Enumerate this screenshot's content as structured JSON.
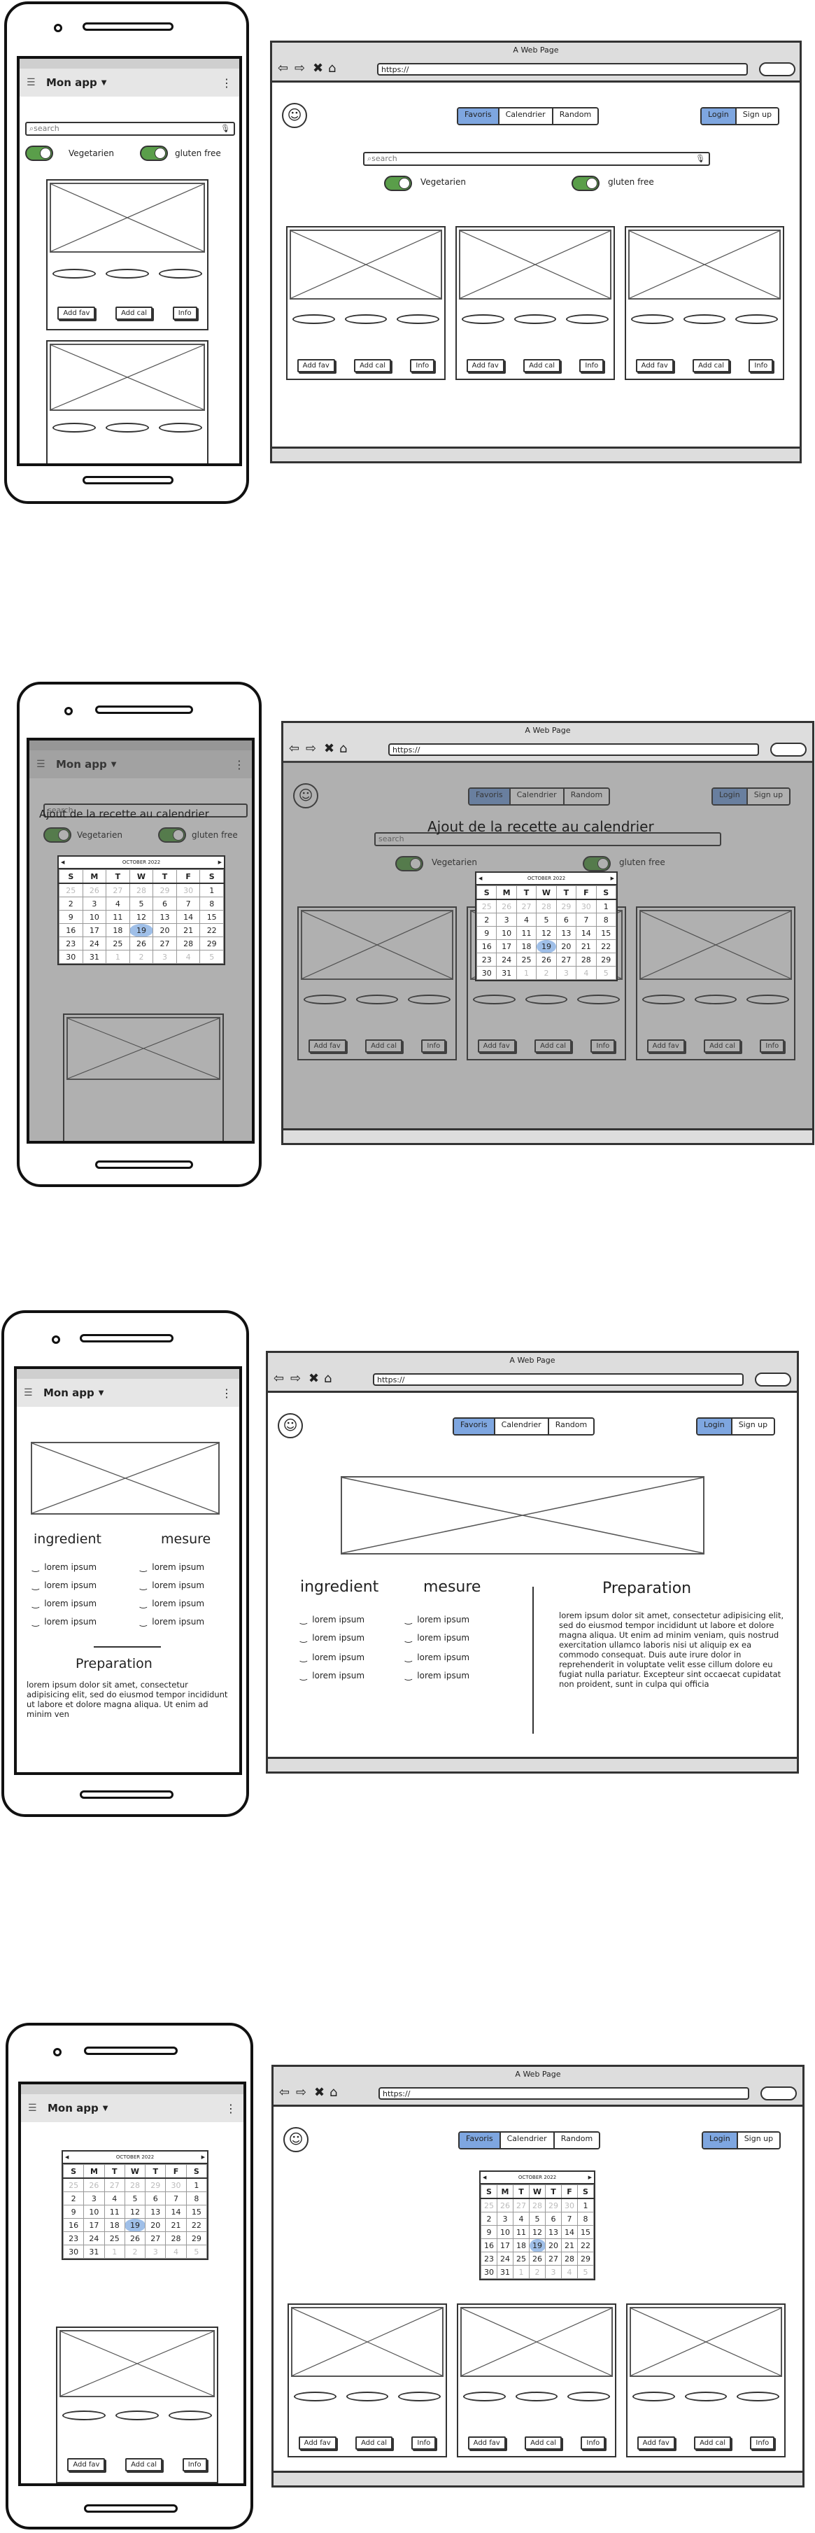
{
  "app_title": "Mon app",
  "browser_title": "A Web Page",
  "url": "https://",
  "nav_tabs": [
    "Favoris",
    "Calendrier",
    "Random"
  ],
  "auth": {
    "login": "Login",
    "signup": "Sign up"
  },
  "search": {
    "placeholder": "search"
  },
  "filters": {
    "vegetarien": "Vegetarien",
    "gluten_free": "gluten free"
  },
  "card_buttons": {
    "add_fav": "Add fav",
    "add_cal": "Add cal",
    "info": "Info"
  },
  "modal_title": "Ajout de la recette au calendrier",
  "calendar": {
    "month": "OCTOBER 2022",
    "weekdays": [
      "S",
      "M",
      "T",
      "W",
      "T",
      "F",
      "S"
    ],
    "rows": [
      [
        "25",
        "26",
        "27",
        "28",
        "29",
        "30",
        "1"
      ],
      [
        "2",
        "3",
        "4",
        "5",
        "6",
        "7",
        "8"
      ],
      [
        "9",
        "10",
        "11",
        "12",
        "13",
        "14",
        "15"
      ],
      [
        "16",
        "17",
        "18",
        "19",
        "20",
        "21",
        "22"
      ],
      [
        "23",
        "24",
        "25",
        "26",
        "27",
        "28",
        "29"
      ],
      [
        "30",
        "31",
        "1",
        "2",
        "3",
        "4",
        "5"
      ]
    ],
    "today": "19"
  },
  "recipe": {
    "ingredient_header": "ingredient",
    "mesure_header": "mesure",
    "item": "lorem ipsum",
    "preparation_header": "Preparation",
    "preparation_text_short": "lorem ipsum dolor sit amet, consectetur adipisicing elit, sed do eiusmod tempor incididunt ut labore et dolore magna aliqua. Ut enim ad minim ven",
    "preparation_text_long": "lorem ipsum dolor sit amet, consectetur adipisicing elit, sed do eiusmod tempor incididunt ut labore et dolore magna aliqua. Ut enim ad minim veniam, quis nostrud exercitation ullamco laboris nisi ut aliquip ex ea commodo consequat. Duis aute irure dolor in reprehenderit in voluptate velit esse cillum dolore eu fugiat nulla pariatur. Excepteur sint occaecat cupidatat non proident, sunt in culpa qui officia"
  }
}
